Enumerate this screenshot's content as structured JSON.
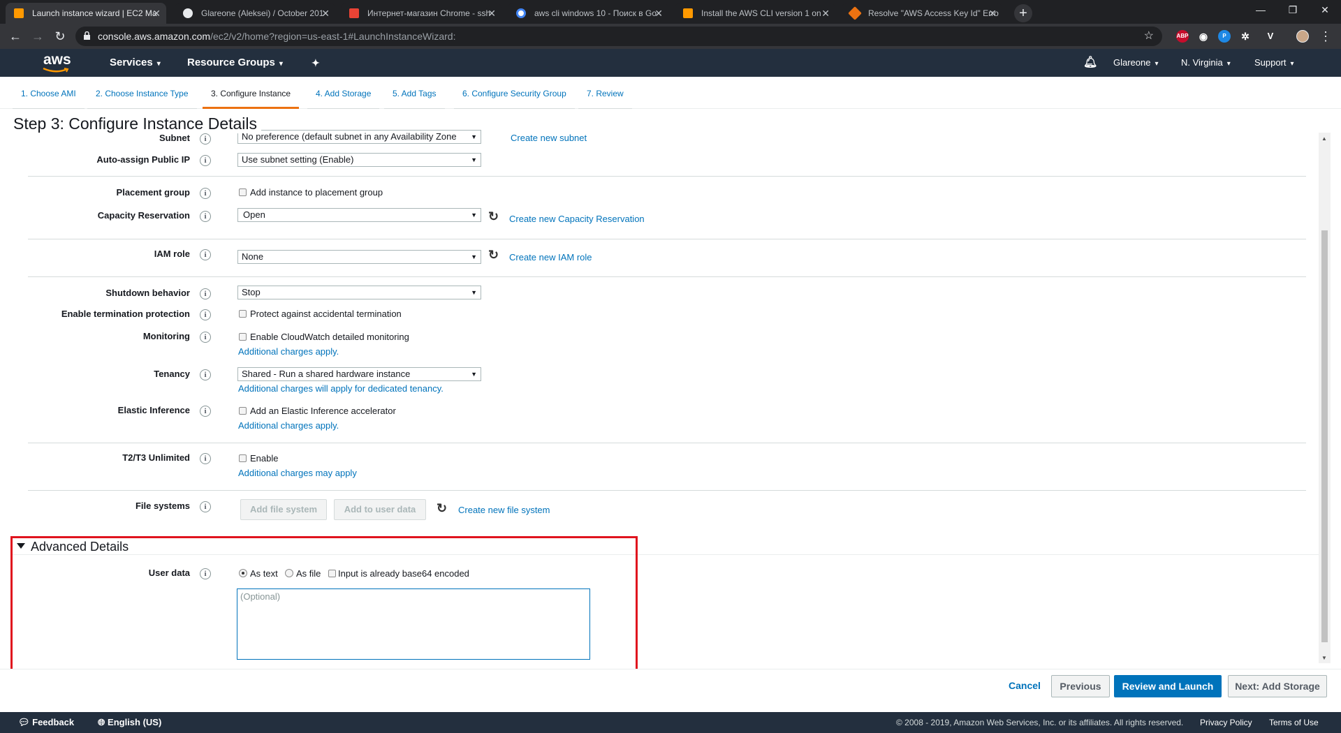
{
  "browser": {
    "tabs": [
      {
        "title": "Launch instance wizard | EC2 Ma",
        "color": "#ff9900"
      },
      {
        "title": "Glareone (Aleksei) / October 201",
        "color": "#e8eaed"
      },
      {
        "title": "Интернет-магазин Chrome - ssh",
        "color": "#ea4335"
      },
      {
        "title": "aws cli windows 10 - Поиск в Go",
        "color": "#4285f4"
      },
      {
        "title": "Install the AWS CLI version 1 on",
        "color": "#ff9900"
      },
      {
        "title": "Resolve \"AWS Access Key Id\" Erro",
        "color": "#ec7211"
      }
    ],
    "url_host": "console.aws.amazon.com",
    "url_path": "/ec2/v2/home?region=us-east-1#LaunchInstanceWizard:",
    "extensions": [
      {
        "label": "ABP",
        "color": "#c70d2c"
      },
      {
        "label": "◉",
        "color": "#35363a"
      },
      {
        "label": "P",
        "color": "#1e88e5"
      },
      {
        "label": "✲",
        "color": "#35363a"
      },
      {
        "label": "V",
        "color": "#35363a"
      }
    ]
  },
  "aws_header": {
    "logo": "aws",
    "services": "Services",
    "resource_groups": "Resource Groups",
    "user": "Glareone",
    "region": "N. Virginia",
    "support": "Support"
  },
  "wizard_tabs": [
    {
      "label": "1. Choose AMI"
    },
    {
      "label": "2. Choose Instance Type"
    },
    {
      "label": "3. Configure Instance"
    },
    {
      "label": "4. Add Storage"
    },
    {
      "label": "5. Add Tags"
    },
    {
      "label": "6. Configure Security Group"
    },
    {
      "label": "7. Review"
    }
  ],
  "page_title": "Step 3: Configure Instance Details",
  "form": {
    "subnet": {
      "label": "Subnet",
      "value": "No preference (default subnet in any Availability Zone",
      "link": "Create new subnet"
    },
    "public_ip": {
      "label": "Auto-assign Public IP",
      "value": "Use subnet setting (Enable)"
    },
    "placement": {
      "label": "Placement group",
      "check": "Add instance to placement group"
    },
    "capacity": {
      "label": "Capacity Reservation",
      "value": "Open",
      "link": "Create new Capacity Reservation"
    },
    "iam": {
      "label": "IAM role",
      "value": "None",
      "link": "Create new IAM role"
    },
    "shutdown": {
      "label": "Shutdown behavior",
      "value": "Stop"
    },
    "termination": {
      "label": "Enable termination protection",
      "check": "Protect against accidental termination"
    },
    "monitoring": {
      "label": "Monitoring",
      "check": "Enable CloudWatch detailed monitoring",
      "note": "Additional charges apply."
    },
    "tenancy": {
      "label": "Tenancy",
      "value": "Shared - Run a shared hardware instance",
      "note": "Additional charges will apply for dedicated tenancy."
    },
    "elastic": {
      "label": "Elastic Inference",
      "check": "Add an Elastic Inference accelerator",
      "note": "Additional charges apply."
    },
    "t2t3": {
      "label": "T2/T3 Unlimited",
      "check": "Enable",
      "note": "Additional charges may apply"
    },
    "filesystems": {
      "label": "File systems",
      "btn_add": "Add file system",
      "btn_userdata": "Add to user data",
      "link": "Create new file system"
    }
  },
  "advanced": {
    "title": "Advanced Details",
    "user_data_label": "User data",
    "opt_text": "As text",
    "opt_file": "As file",
    "opt_base64": "Input is already base64 encoded",
    "placeholder": "(Optional)"
  },
  "actions": {
    "cancel": "Cancel",
    "previous": "Previous",
    "review": "Review and Launch",
    "next": "Next: Add Storage"
  },
  "footer": {
    "feedback": "Feedback",
    "language": "English (US)",
    "copyright": "© 2008 - 2019, Amazon Web Services, Inc. or its affiliates. All rights reserved.",
    "privacy": "Privacy Policy",
    "terms": "Terms of Use"
  }
}
